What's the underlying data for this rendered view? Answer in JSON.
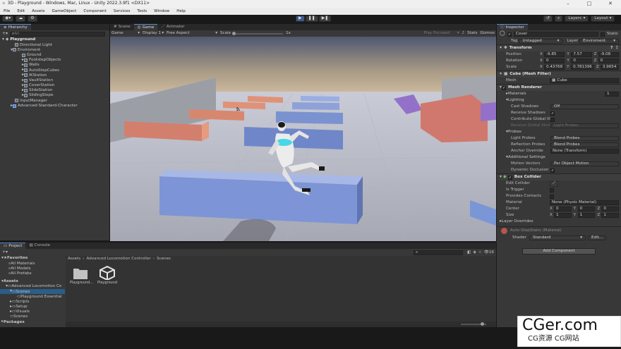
{
  "window": {
    "title": "3D - Playground - Windows, Mac, Linux - Unity 2022.3.9f1 <DX11>"
  },
  "menu": [
    "File",
    "Edit",
    "Assets",
    "GameObject",
    "Component",
    "Services",
    "Tools",
    "Window",
    "Help"
  ],
  "toolbar": {
    "layers": "Layers",
    "layout": "Layout"
  },
  "hierarchy": {
    "tab": "Hierarchy",
    "scene": "Playground",
    "items": [
      "Directional Light",
      "Enviroment",
      "Ground",
      "FootstepObjects",
      "Walls",
      "AutoStepCubes",
      "IKStation",
      "VaultStation",
      "CoverStation",
      "SlideStation",
      "SlidingSlope",
      "InputManager",
      "Advanced-Standard-Character"
    ]
  },
  "viewtabs": [
    "Scene",
    "Game",
    "Animator"
  ],
  "gamebar": {
    "mode": "Game",
    "display": "Display 1",
    "aspect": "Free Aspect",
    "scale_label": "Scale",
    "scale_val": "1x",
    "paused": "Play Focused",
    "stats": "Stats",
    "gizmos": "Gizmos"
  },
  "inspector": {
    "tab": "Inspector",
    "name": "Cover",
    "static": "Static",
    "tag_label": "Tag",
    "tag": "Untagged",
    "layer_label": "Layer",
    "layer": "Enviroment",
    "transform": {
      "title": "Transform",
      "position_label": "Position",
      "rotation_label": "Rotation",
      "scale_label": "Scale",
      "position": [
        "-9.85",
        "7.57",
        "-9.08"
      ],
      "rotation": [
        "0",
        "0",
        "0"
      ],
      "scale": [
        "0.43768",
        "0.781396",
        "3.9654"
      ]
    },
    "meshfilter": {
      "title": "Cube (Mesh Filter)",
      "mesh_label": "Mesh",
      "mesh": "Cube"
    },
    "renderer": {
      "title": "Mesh Renderer",
      "materials": "Materials",
      "materials_count": "1",
      "lighting": "Lighting",
      "cast_label": "Cast Shadows",
      "cast": "Off",
      "receive_label": "Receive Shadows",
      "contrib_label": "Contribute Global Illu",
      "gi_label": "Receive Global Illum",
      "gi": "Light Probes",
      "probes": "Probes",
      "lp_label": "Light Probes",
      "lp": "Blend Probes",
      "rp_label": "Reflection Probes",
      "rp": "Blend Probes",
      "anchor_label": "Anchor Override",
      "anchor": "None (Transform)",
      "additional": "Additional Settings",
      "motion_label": "Motion Vectors",
      "motion": "Per Object Motion",
      "occl_label": "Dynamic Occlusion"
    },
    "collider": {
      "title": "Box Collider",
      "edit_label": "Edit Collider",
      "trigger_label": "Is Trigger",
      "contacts_label": "Provides Contacts",
      "material_label": "Material",
      "material": "None (Physic Material)",
      "center_label": "Center",
      "center": [
        "0",
        "0",
        "0"
      ],
      "size_label": "Size",
      "size": [
        "1",
        "1",
        "1"
      ],
      "overrides": "Layer Overrides"
    },
    "material": {
      "name": "Auto-StepStairs (Material)",
      "shader_label": "Shader",
      "shader": "Standard",
      "edit": "Edit..."
    },
    "add_component": "Add Component"
  },
  "project": {
    "tabs": [
      "Project",
      "Console"
    ],
    "breadcrumb": [
      "Assets",
      "Advanced Locomotion Controller",
      "Scenes"
    ],
    "favorites": "Favorites",
    "fav_items": [
      "All Materials",
      "All Models",
      "All Prefabs"
    ],
    "assets": "Assets",
    "tree": [
      "Advanced Locomotion Co",
      "Scenes",
      "Playground Essential",
      "Scripts",
      "Setup",
      "Visuals",
      "Scenes"
    ],
    "packages": "Packages",
    "files": [
      {
        "name": "Playground...",
        "icon": "folder-icon"
      },
      {
        "name": "Playground",
        "icon": "unity-scene-icon"
      }
    ],
    "count": "16"
  },
  "watermark": {
    "big": "CGer.com",
    "small": "CG资源 CG网站"
  }
}
